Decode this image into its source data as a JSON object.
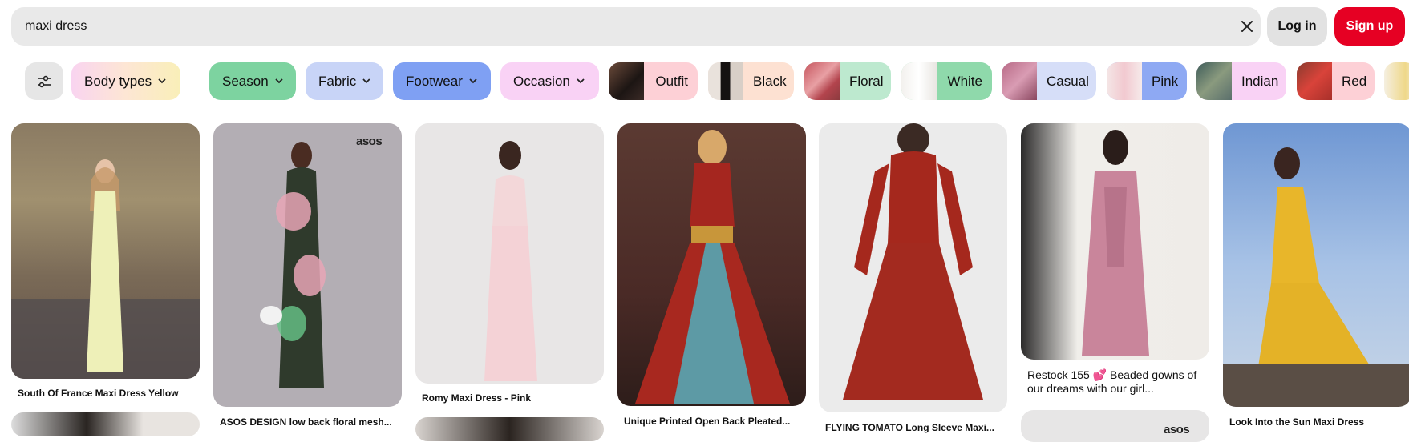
{
  "search": {
    "query": "maxi dress",
    "clear_icon": "close-icon"
  },
  "auth": {
    "login_label": "Log in",
    "signup_label": "Sign up"
  },
  "colors": {
    "brand_red": "#e60023",
    "search_bg": "#e9e9e9"
  },
  "filters": {
    "settings_icon": "sliders-icon",
    "dropdowns": [
      {
        "label": "Body types",
        "color": "#fce3d9"
      },
      {
        "label": "Season",
        "color": "#7dd3a0"
      },
      {
        "label": "Fabric",
        "color": "#c8d4f7"
      },
      {
        "label": "Footwear",
        "color": "#7fa0f3"
      },
      {
        "label": "Occasion",
        "color": "#f9d2f5"
      }
    ],
    "suggestions": [
      {
        "label": "Outfit",
        "color": "#fdd0d6"
      },
      {
        "label": "Black",
        "color": "#fde1d2"
      },
      {
        "label": "Floral",
        "color": "#bde9cf"
      },
      {
        "label": "White",
        "color": "#8fd9ab"
      },
      {
        "label": "Casual",
        "color": "#d6def8"
      },
      {
        "label": "Pink",
        "color": "#8ea9f3"
      },
      {
        "label": "Indian",
        "color": "#f9d2f5"
      },
      {
        "label": "Red",
        "color": "#fdd0d6"
      }
    ]
  },
  "pins": [
    {
      "title": "South Of France Maxi Dress Yellow",
      "brand": ""
    },
    {
      "title": "ASOS DESIGN low back floral mesh...",
      "brand": "asos"
    },
    {
      "title": "Romy Maxi Dress - Pink",
      "brand": ""
    },
    {
      "title": "Unique Printed Open Back Pleated...",
      "brand": ""
    },
    {
      "title": "FLYING TOMATO Long Sleeve Maxi...",
      "brand": ""
    },
    {
      "title": "Restock 155 💕 Beaded gowns of our dreams with our girl...",
      "brand": "asos"
    },
    {
      "title": "Look Into the Sun Maxi Dress",
      "brand": ""
    }
  ]
}
